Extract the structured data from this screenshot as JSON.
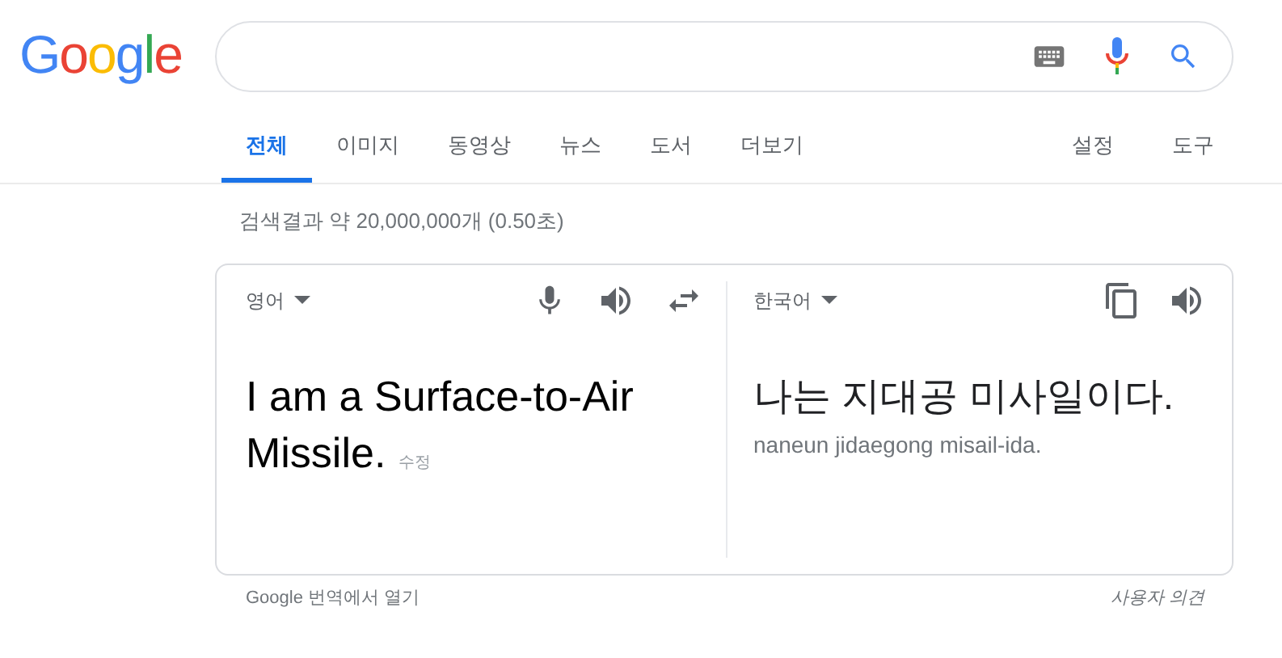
{
  "logo": "Google",
  "tabs": [
    {
      "label": "전체",
      "selected": true
    },
    {
      "label": "이미지",
      "selected": false
    },
    {
      "label": "동영상",
      "selected": false
    },
    {
      "label": "뉴스",
      "selected": false
    },
    {
      "label": "도서",
      "selected": false
    },
    {
      "label": "더보기",
      "selected": false
    }
  ],
  "tools": [
    "설정",
    "도구"
  ],
  "result_stats": "검색결과 약 20,000,000개 (0.50초)",
  "translate": {
    "source_lang": "영어",
    "target_lang": "한국어",
    "source_lines": [
      "I am a Surface-to-Air",
      "Missile."
    ],
    "edit": "수정",
    "target_text": "나는 지대공 미사일이다.",
    "romanization": "naneun jidaegong misail-ida."
  },
  "footer": {
    "open_link": "Google 번역에서 열기",
    "feedback": "사용자 의견"
  }
}
